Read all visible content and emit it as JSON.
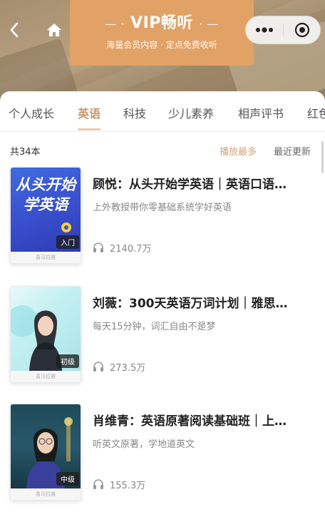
{
  "header": {
    "title": "VIP畅听",
    "subtitle": "海量会员内容 · 定点免费收听",
    "dash_left": "— ·",
    "dash_right": "· —"
  },
  "tabs": [
    {
      "label": "个人成长"
    },
    {
      "label": "英语"
    },
    {
      "label": "科技"
    },
    {
      "label": "少儿素养"
    },
    {
      "label": "相声评书"
    },
    {
      "label": "红色"
    }
  ],
  "list": {
    "count": "共34本",
    "sort_hot": "播放最多",
    "sort_new": "最近更新",
    "items": [
      {
        "title": "顾悦：从头开始学英语｜英语口语…",
        "desc": "上外教授带你零基础系统学好英语",
        "plays": "2140.7万",
        "level": "入门",
        "cover_text": "从头开始学英语",
        "cover_line1": "从头开始",
        "cover_line2": "学英语",
        "publisher": "喜马拉雅"
      },
      {
        "title": "刘薇：300天英语万词计划｜雅思…",
        "desc": "每天15分钟，词汇自由不是梦",
        "plays": "273.5万",
        "level": "初级",
        "publisher": "喜马拉雅"
      },
      {
        "title": "肖维青：英语原著阅读基础班｜上…",
        "desc": "听英文原著，学地道英文",
        "plays": "155.3万",
        "level": "中级",
        "publisher": "喜马拉雅"
      }
    ]
  },
  "colors": {
    "accent": "#c8956a",
    "title_card": "#e2a265"
  }
}
